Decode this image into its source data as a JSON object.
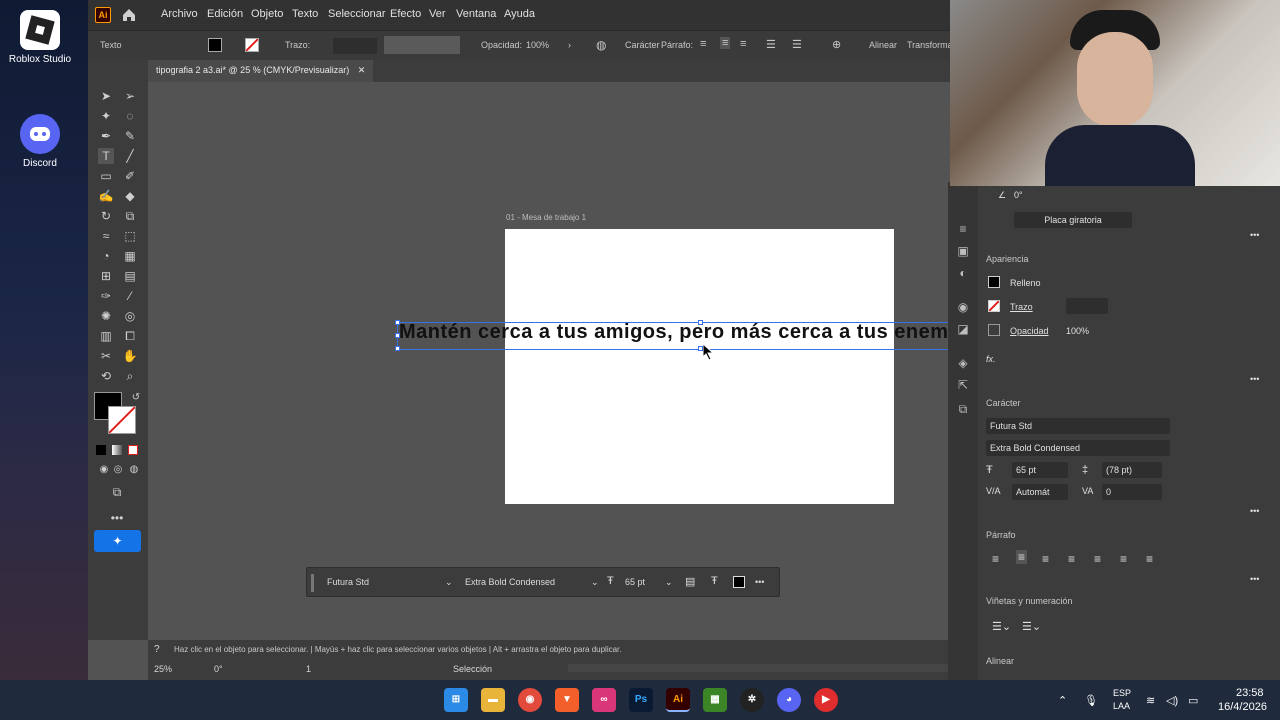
{
  "desktop": {
    "icons": [
      {
        "label": "Roblox Studio",
        "icon": "roblox-studio-icon"
      },
      {
        "label": "Discord",
        "icon": "discord-icon"
      }
    ]
  },
  "menubar": {
    "app_logo": "Ai",
    "items": [
      "Archivo",
      "Edición",
      "Objeto",
      "Texto",
      "Seleccionar",
      "Efecto",
      "Ver",
      "Ventana",
      "Ayuda"
    ]
  },
  "control_bar": {
    "mode": "Texto",
    "stroke_label": "Trazo:",
    "opacity_label": "Opacidad:",
    "opacity_value": "100%",
    "character_label": "Carácter",
    "paragraph_label": "Párrafo:",
    "align_label": "Alinear",
    "transform_label": "Transforma"
  },
  "document": {
    "tab_title": "tipografia 2 a3.ai* @ 25 % (CMYK/Previsualizar)",
    "artboard_label": "01 - Mesa de trabajo 1",
    "text": "Mantén cerca a tus amigos,  pero más cerca a tus enemigos"
  },
  "context_bar": {
    "font": "Futura Std",
    "style": "Extra Bold Condensed",
    "size": "65 pt"
  },
  "statusbar": {
    "hint": "Haz clic en el objeto para seleccionar.  |  Mayús + haz clic para seleccionar varios objetos  |  Alt + arrastra el objeto para duplicar.",
    "zoom": "25%",
    "rotation": "0°",
    "artboard_number": "1",
    "tool": "Selección"
  },
  "panel": {
    "angle": "0°",
    "rotate_view_button": "Placa giratoria",
    "appearance_title": "Apariencia",
    "fill_label": "Relleno",
    "stroke_label": "Trazo",
    "opacity_label": "Opacidad",
    "opacity_value": "100%",
    "fx_label": "fx.",
    "character_title": "Carácter",
    "font_family": "Futura Std",
    "font_style": "Extra Bold Condensed",
    "font_size": "65 pt",
    "leading": "(78 pt)",
    "kerning": "Automát",
    "tracking": "0",
    "paragraph_title": "Párrafo",
    "bullets_title": "Viñetas y numeración",
    "align_title": "Alinear"
  },
  "taskbar": {
    "language": "ESP",
    "region": "LAA",
    "time": "23:58",
    "date": "16/4/2026"
  }
}
